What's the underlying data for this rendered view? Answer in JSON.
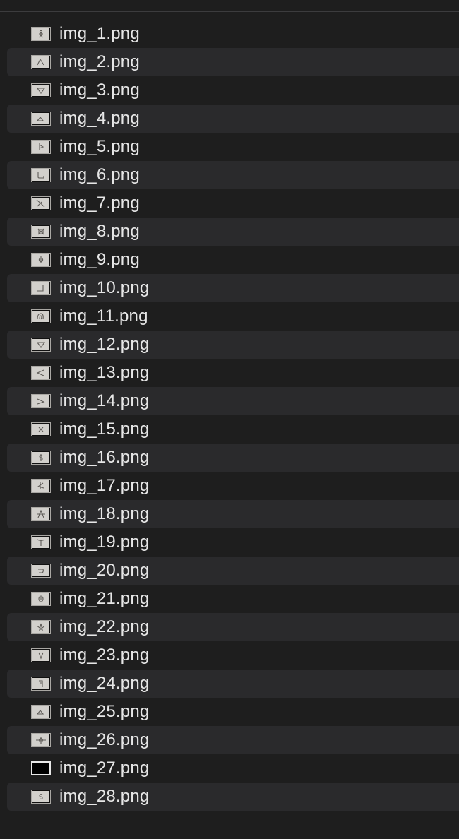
{
  "files": [
    {
      "name": "img_1.png",
      "icon": "stick-figure-icon"
    },
    {
      "name": "img_2.png",
      "icon": "arch-icon"
    },
    {
      "name": "img_3.png",
      "icon": "down-triangle-icon"
    },
    {
      "name": "img_4.png",
      "icon": "mound-icon"
    },
    {
      "name": "img_5.png",
      "icon": "flag-icon"
    },
    {
      "name": "img_6.png",
      "icon": "step-line-icon"
    },
    {
      "name": "img_7.png",
      "icon": "cross-angle-icon"
    },
    {
      "name": "img_8.png",
      "icon": "crossed-box-icon"
    },
    {
      "name": "img_9.png",
      "icon": "phi-icon"
    },
    {
      "name": "img_10.png",
      "icon": "corner-icon"
    },
    {
      "name": "img_11.png",
      "icon": "loop-icon"
    },
    {
      "name": "img_12.png",
      "icon": "down-triangle-icon"
    },
    {
      "name": "img_13.png",
      "icon": "less-than-icon"
    },
    {
      "name": "img_14.png",
      "icon": "greater-than-icon"
    },
    {
      "name": "img_15.png",
      "icon": "x-mark-icon"
    },
    {
      "name": "img_16.png",
      "icon": "dollar-icon"
    },
    {
      "name": "img_17.png",
      "icon": "k-shape-icon"
    },
    {
      "name": "img_18.png",
      "icon": "a-frame-icon"
    },
    {
      "name": "img_19.png",
      "icon": "y-shape-icon"
    },
    {
      "name": "img_20.png",
      "icon": "hook-icon"
    },
    {
      "name": "img_21.png",
      "icon": "oval-icon"
    },
    {
      "name": "img_22.png",
      "icon": "star-icon"
    },
    {
      "name": "img_23.png",
      "icon": "v-shape-icon"
    },
    {
      "name": "img_24.png",
      "icon": "hook-down-icon"
    },
    {
      "name": "img_25.png",
      "icon": "mound-icon"
    },
    {
      "name": "img_26.png",
      "icon": "crosshair-icon"
    },
    {
      "name": "img_27.png",
      "icon": "black-image-icon"
    },
    {
      "name": "img_28.png",
      "icon": "s-shape-icon"
    }
  ],
  "colors": {
    "background": "#1e1e1e",
    "row_alt": "#2a2a2c",
    "text": "#e6e6e6"
  }
}
